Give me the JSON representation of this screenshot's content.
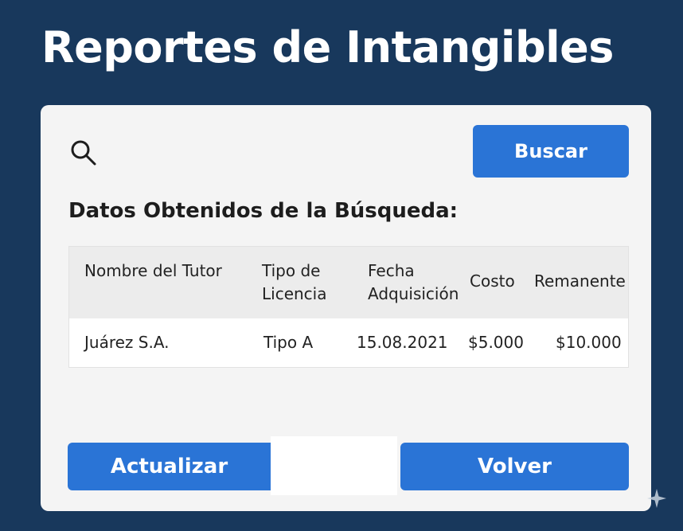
{
  "page": {
    "title": "Reportes de Intangibles"
  },
  "search": {
    "button_label": "Buscar"
  },
  "results": {
    "title": "Datos Obtenidos de la Búsqueda:",
    "columns": [
      {
        "line1": "Nombre del Tutor",
        "line2": ""
      },
      {
        "line1": "Tipo de",
        "line2": "Licencia"
      },
      {
        "line1": "Fecha",
        "line2": "Adquisición"
      },
      {
        "line1": "Costo",
        "line2": ""
      },
      {
        "line1": "Remanente",
        "line2": ""
      }
    ],
    "rows": [
      [
        "Juárez S.A.",
        "Tipo A",
        "15.08.2021",
        "$5.000",
        "$10.000"
      ]
    ]
  },
  "actions": {
    "update_label": "Actualizar",
    "back_label": "Volver"
  },
  "colors": {
    "background": "#18385c",
    "card": "#f4f4f4",
    "accent": "#2a74d6"
  },
  "icons": {
    "search": "search-icon",
    "corner": "sparkle-icon"
  }
}
